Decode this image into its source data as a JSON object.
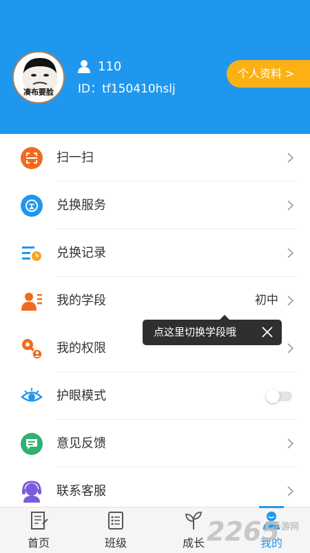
{
  "colors": {
    "primary": "#1f97ef",
    "accent": "#fbb114"
  },
  "header": {
    "avatar_caption": "凑布要脸",
    "user_name": "110",
    "user_id": "ID：tf150410hslj",
    "profile_button": "个人资料 >"
  },
  "menu": {
    "items": [
      {
        "label": "扫一扫",
        "icon": "scan-icon"
      },
      {
        "label": "兑换服务",
        "icon": "exchange-icon"
      },
      {
        "label": "兑换记录",
        "icon": "record-icon"
      },
      {
        "label": "我的学段",
        "icon": "grade-icon",
        "value": "初中"
      },
      {
        "label": "我的权限",
        "icon": "key-icon"
      },
      {
        "label": "护眼模式",
        "icon": "eye-icon",
        "toggle": false
      },
      {
        "label": "意见反馈",
        "icon": "feedback-icon"
      },
      {
        "label": "联系客服",
        "icon": "headset-icon"
      }
    ]
  },
  "tooltip": {
    "text": "点这里切换学段哦"
  },
  "tabbar": {
    "tabs": [
      {
        "label": "首页",
        "icon": "home-book-icon",
        "active": false
      },
      {
        "label": "班级",
        "icon": "class-list-icon",
        "active": false
      },
      {
        "label": "成长",
        "icon": "sprout-icon",
        "active": false
      },
      {
        "label": "我的",
        "icon": "person-icon",
        "active": true
      }
    ]
  },
  "watermark": {
    "main": "2265",
    "sub": "手游网"
  }
}
